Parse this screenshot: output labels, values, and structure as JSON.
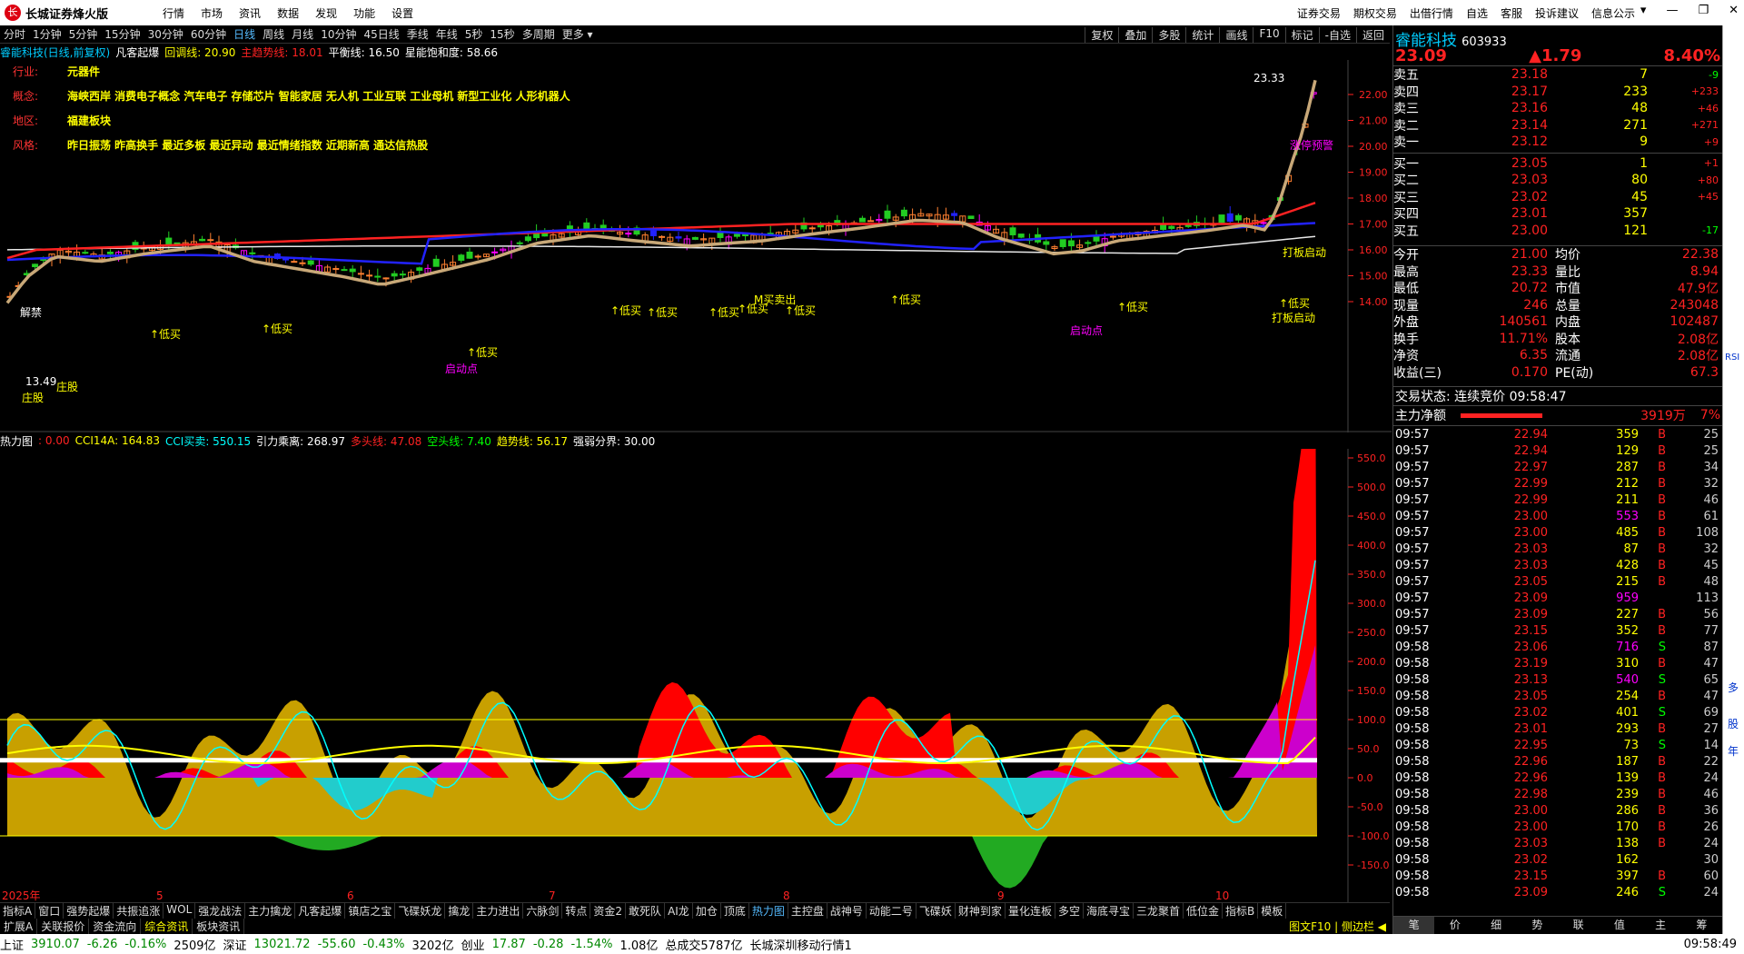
{
  "app": {
    "title": "长城证券烽火版",
    "menus": [
      "行情",
      "市场",
      "资讯",
      "数据",
      "发现",
      "功能",
      "设置"
    ],
    "right": [
      "证券交易",
      "期权交易",
      "出借行情",
      "自选",
      "客服",
      "投诉建议",
      "信息公示"
    ],
    "win": [
      "▾",
      "—",
      "❐",
      "✕"
    ]
  },
  "periods": {
    "items": [
      "分时",
      "1分钟",
      "5分钟",
      "15分钟",
      "30分钟",
      "60分钟",
      "日线",
      "周线",
      "月线",
      "10分钟",
      "45日线",
      "季线",
      "年线",
      "5秒",
      "15秒",
      "多周期",
      "更多 ▾"
    ],
    "active": 6,
    "right": [
      "复权",
      "叠加",
      "多股",
      "统计",
      "画线",
      "F10",
      "标记",
      "-自选",
      "返回"
    ]
  },
  "info": {
    "name": "睿能科技(日线,前复权)",
    "ind": "凡客起爆",
    "a": "回调线: 20.90",
    "b": "主趋势线: 18.01",
    "c": "平衡线: 16.50",
    "d": "星能饱和度: 58.66"
  },
  "tags": [
    {
      "k": "行业:",
      "v": "元器件"
    },
    {
      "k": "概念:",
      "v": "海峡西岸 消费电子概念 汽车电子 存储芯片 智能家居 无人机 工业互联 工业母机 新型工业化 人形机器人"
    },
    {
      "k": "地区:",
      "v": "福建板块"
    },
    {
      "k": "风格:",
      "v": "昨日振荡 昨高换手 最近多板 最近异动 最近情绪指数 近期新高 通达信热股"
    }
  ],
  "priceAxis": [
    "22.00",
    "21.00",
    "20.00",
    "19.00",
    "18.00",
    "17.00",
    "16.00",
    "15.00",
    "14.00"
  ],
  "indAxis": [
    "550.0",
    "500.0",
    "450.0",
    "400.0",
    "350.0",
    "300.0",
    "250.0",
    "200.0",
    "150.0",
    "100.0",
    "50.0",
    "0.0",
    "-50.0",
    "-100.0",
    "-150.0"
  ],
  "labels": {
    "high": "23.33",
    "low": "13.49",
    "zh": "涨停预警",
    "dbq": "打板启动",
    "dbq2": "打板启动",
    "qd": "启动点",
    "qd2": "启动点",
    "dm": "低买",
    "sd": "庄股",
    "sd2": "庄股",
    "dx": "解禁",
    "mb": "M买卖出"
  },
  "ind": {
    "name": "热力图",
    "v0": ": 0.00",
    "cci": "CCI14A: 164.83",
    "ccib": "CCI买卖: 550.15",
    "yl": "引力乘离: 268.97",
    "dt": "多头线: 47.08",
    "kt": "空头线: 7.40",
    "qs": "趋势线: 56.17",
    "qr": "强弱分界: 30.00"
  },
  "dates": [
    "2025年",
    "5",
    "6",
    "7",
    "8",
    "9",
    "10"
  ],
  "tabs1": [
    "指标A",
    "窗口",
    "强势起爆",
    "共振追涨",
    "WOL",
    "强龙战法",
    "主力擒龙",
    "凡客起爆",
    "镇店之宝",
    "飞碟妖龙",
    "擒龙",
    "主力进出",
    "六脉剑",
    "转点",
    "资金2",
    "敢死队",
    "AI龙",
    "加仓",
    "顶底",
    "热力图",
    "主控盘",
    "战神号",
    "动能二号",
    "飞碟妖",
    "财神到家",
    "量化连板",
    "多空",
    "海底寻宝",
    "三龙聚首",
    "低位金",
    "指标B",
    "模板"
  ],
  "tabs2": [
    "扩展A",
    "关联报价",
    "资金流向",
    "综合资讯",
    "板块资讯"
  ],
  "tabs2r": "图文F10 | 侧边栏 ◀",
  "status": {
    "sh": "上证",
    "shv": "3910.07",
    "shc": "-6.26",
    "shp": "-0.16%",
    "sha": "2509亿",
    "sz": "深证",
    "szv": "13021.72",
    "szc": "-55.60",
    "szp": "-0.43%",
    "sza": "3202亿",
    "cy": "创业",
    "cyv": "17.87",
    "cyc": "-0.28",
    "cyp": "-1.54%",
    "cya": "1.08亿",
    "tot": "总成交5787亿",
    "feed": "长城深圳移动行情1",
    "time": "09:58:49"
  },
  "stock": {
    "name": "睿能科技",
    "code": "603933",
    "price": "23.09",
    "chg": "▲1.79",
    "pct": "8.40%"
  },
  "asks": [
    [
      "卖五",
      "23.18",
      "7",
      "-9"
    ],
    [
      "卖四",
      "23.17",
      "233",
      "+233"
    ],
    [
      "卖三",
      "23.16",
      "48",
      "+46"
    ],
    [
      "卖二",
      "23.14",
      "271",
      "+271"
    ],
    [
      "卖一",
      "23.12",
      "9",
      "+9"
    ]
  ],
  "bids": [
    [
      "买一",
      "23.05",
      "1",
      "+1"
    ],
    [
      "买二",
      "23.03",
      "80",
      "+80"
    ],
    [
      "买三",
      "23.02",
      "45",
      "+45"
    ],
    [
      "买四",
      "23.01",
      "357",
      ""
    ],
    [
      "买五",
      "23.00",
      "121",
      "-17"
    ]
  ],
  "quote": [
    [
      "今开",
      "21.00",
      "均价",
      "22.38"
    ],
    [
      "最高",
      "23.33",
      "量比",
      "8.94"
    ],
    [
      "最低",
      "20.72",
      "市值",
      "47.9亿"
    ],
    [
      "现量",
      "246",
      "总量",
      "243048"
    ],
    [
      "外盘",
      "140561",
      "内盘",
      "102487"
    ],
    [
      "换手",
      "11.71%",
      "股本",
      "2.08亿"
    ],
    [
      "净资",
      "6.35",
      "流通",
      "2.08亿"
    ],
    [
      "收益(三)",
      "0.170",
      "PE(动)",
      "67.3"
    ]
  ],
  "trade": "交易状态: 连续竞价 09:58:47",
  "flow": {
    "label": "主力净额",
    "v": "3919万",
    "p": "7%"
  },
  "ticks": [
    [
      "09:57",
      "22.94",
      "359",
      "B",
      "25"
    ],
    [
      "09:57",
      "22.94",
      "129",
      "B",
      "25"
    ],
    [
      "09:57",
      "22.97",
      "287",
      "B",
      "34"
    ],
    [
      "09:57",
      "22.99",
      "212",
      "B",
      "32"
    ],
    [
      "09:57",
      "22.99",
      "211",
      "B",
      "46"
    ],
    [
      "09:57",
      "23.00",
      "553",
      "B",
      "61"
    ],
    [
      "09:57",
      "23.00",
      "485",
      "B",
      "108"
    ],
    [
      "09:57",
      "23.03",
      "87",
      "B",
      "32"
    ],
    [
      "09:57",
      "23.03",
      "428",
      "B",
      "45"
    ],
    [
      "09:57",
      "23.05",
      "215",
      "B",
      "48"
    ],
    [
      "09:57",
      "23.09",
      "959",
      "",
      "113"
    ],
    [
      "09:57",
      "23.09",
      "227",
      "B",
      "56"
    ],
    [
      "09:57",
      "23.15",
      "352",
      "B",
      "77"
    ],
    [
      "09:58",
      "23.06",
      "716",
      "S",
      "87"
    ],
    [
      "09:58",
      "23.19",
      "310",
      "B",
      "47"
    ],
    [
      "09:58",
      "23.13",
      "540",
      "S",
      "65"
    ],
    [
      "09:58",
      "23.05",
      "254",
      "B",
      "47"
    ],
    [
      "09:58",
      "23.02",
      "401",
      "S",
      "69"
    ],
    [
      "09:58",
      "23.01",
      "293",
      "B",
      "27"
    ],
    [
      "09:58",
      "22.95",
      "73",
      "S",
      "14"
    ],
    [
      "09:58",
      "22.96",
      "187",
      "B",
      "22"
    ],
    [
      "09:58",
      "22.96",
      "139",
      "B",
      "24"
    ],
    [
      "09:58",
      "22.98",
      "239",
      "B",
      "46"
    ],
    [
      "09:58",
      "23.00",
      "286",
      "B",
      "36"
    ],
    [
      "09:58",
      "23.00",
      "170",
      "B",
      "26"
    ],
    [
      "09:58",
      "23.03",
      "138",
      "B",
      "24"
    ],
    [
      "09:58",
      "23.02",
      "162",
      "",
      "30"
    ],
    [
      "09:58",
      "23.15",
      "397",
      "B",
      "60"
    ],
    [
      "09:58",
      "23.09",
      "246",
      "S",
      "24"
    ]
  ],
  "rtabs": [
    "笔",
    "价",
    "细",
    "势",
    "联",
    "值",
    "主",
    "筹"
  ],
  "sidebar": [
    "RSI",
    "多",
    "股",
    "年"
  ]
}
